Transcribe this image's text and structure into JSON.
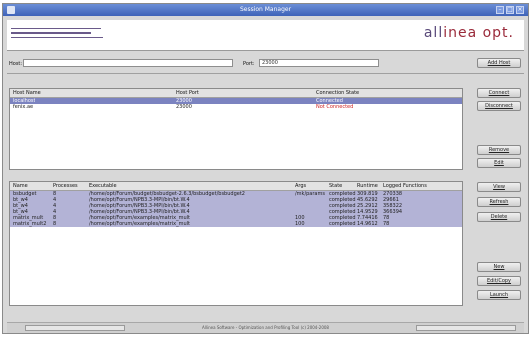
{
  "window": {
    "title": "Session Manager"
  },
  "logo": {
    "prefix": "all",
    "text": "inea opt."
  },
  "connection": {
    "host_label": "Host:",
    "host_value": "",
    "port_label": "Port:",
    "port_value": "23000",
    "add_host_label": "Add Host"
  },
  "hosts_table": {
    "columns": [
      "Host Name",
      "Host Port",
      "Connection State"
    ],
    "rows": [
      {
        "name": "localhost",
        "port": "23000",
        "state": "Connected",
        "selected": true
      },
      {
        "name": "fenix.ae",
        "port": "23000",
        "state": "Not Connected",
        "selected": false
      }
    ]
  },
  "host_buttons": {
    "connect": "Connect",
    "disconnect": "Disconnect",
    "remove": "Remove",
    "edit": "Edit"
  },
  "jobs_table": {
    "columns": [
      "Name",
      "Processes",
      "Executable",
      "Args",
      "State",
      "Runtime",
      "Logged Functions"
    ],
    "rows": [
      {
        "name": "bsbudget",
        "procs": "8",
        "exe": "/home/opt/Forum/budget/bsbudget-2.6.3/bsbudget/bsbudget2",
        "args": "/mk/params",
        "state": "completed",
        "runtime": "309.819",
        "funcs": "270338"
      },
      {
        "name": "bt_w4",
        "procs": "4",
        "exe": "/home/opt/Forum/NPB3.3-MPI/bin/bt.W.4",
        "args": "",
        "state": "completed",
        "runtime": "45.6292",
        "funcs": "29661"
      },
      {
        "name": "bt_w4",
        "procs": "4",
        "exe": "/home/opt/Forum/NPB3.3-MPI/bin/bt.W.4",
        "args": "",
        "state": "completed",
        "runtime": "25.2912",
        "funcs": "358322"
      },
      {
        "name": "bt_w4",
        "procs": "4",
        "exe": "/home/opt/Forum/NPB3.3-MPI/bin/bt.W.4",
        "args": "",
        "state": "completed",
        "runtime": "14.9529",
        "funcs": "366394"
      },
      {
        "name": "matrix_mult",
        "procs": "8",
        "exe": "/home/opt/Forum/examples/matrix_mult",
        "args": "100",
        "state": "completed",
        "runtime": "7.74416",
        "funcs": "78"
      },
      {
        "name": "matrix_mult2",
        "procs": "8",
        "exe": "/home/opt/Forum/examples/matrix_mult",
        "args": "100",
        "state": "completed",
        "runtime": "14.9612",
        "funcs": "78"
      }
    ]
  },
  "job_buttons": {
    "view": "View",
    "refresh": "Refresh",
    "delete": "Delete",
    "new": "New",
    "edit_copy": "Edit/Copy",
    "launch": "Launch"
  },
  "status_bar": {
    "message": "Allinea Software - Optimization and Profiling Tool (c) 2004-2008"
  },
  "colors": {
    "title_bar": "#4a6fc6",
    "selection": "#7b83c0",
    "job_highlight": "#b3b3d6",
    "not_connected": "#cc2222",
    "logo": "#9a2a3a"
  }
}
